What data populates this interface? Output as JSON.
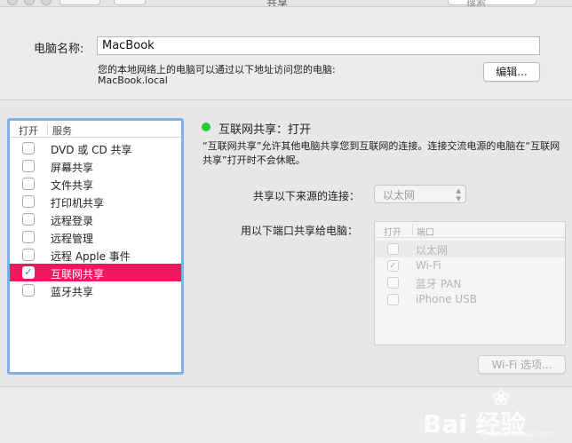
{
  "window": {
    "title": "共享",
    "search_placeholder": "搜索"
  },
  "computer_name": {
    "label": "电脑名称:",
    "value": "MacBook",
    "address_desc": "您的本地网络上的电脑可以通过以下地址访问您的电脑:",
    "address": "MacBook.local",
    "edit_label": "编辑..."
  },
  "services": {
    "header_on": "打开",
    "header_service": "服务",
    "items": [
      {
        "label": "DVD 或 CD 共享",
        "checked": ""
      },
      {
        "label": "屏幕共享",
        "checked": ""
      },
      {
        "label": "文件共享",
        "checked": ""
      },
      {
        "label": "打印机共享",
        "checked": ""
      },
      {
        "label": "远程登录",
        "checked": ""
      },
      {
        "label": "远程管理",
        "checked": ""
      },
      {
        "label": "远程 Apple 事件",
        "checked": ""
      },
      {
        "label": "互联网共享",
        "checked": "✓"
      },
      {
        "label": "蓝牙共享",
        "checked": ""
      }
    ]
  },
  "detail": {
    "status": "互联网共享：打开",
    "status_color": "#27c93f",
    "desc_line1": "“互联网共享”允许其他电脑共享您到互联网的连接。连接交流电源的电脑在“互联网",
    "desc_line2": "共享”打开时不会休眠。",
    "from_label": "共享以下来源的连接：",
    "from_value": "以太网",
    "to_label": "用以下端口共享给电脑：",
    "ports_header_on": "打开",
    "ports_header_port": "端口",
    "ports": [
      {
        "label": "以太网",
        "checked": ""
      },
      {
        "label": "Wi-Fi",
        "checked": "✓"
      },
      {
        "label": "蓝牙 PAN",
        "checked": ""
      },
      {
        "label": "iPhone USB",
        "checked": ""
      }
    ],
    "wifi_options_label": "Wi-Fi 选项..."
  },
  "watermark": {
    "text": "Bai 经验",
    "url": "jingyan.baidu.com"
  },
  "colors": {
    "selection": "#f0185f",
    "focus_ring": "#7fb0ea"
  }
}
